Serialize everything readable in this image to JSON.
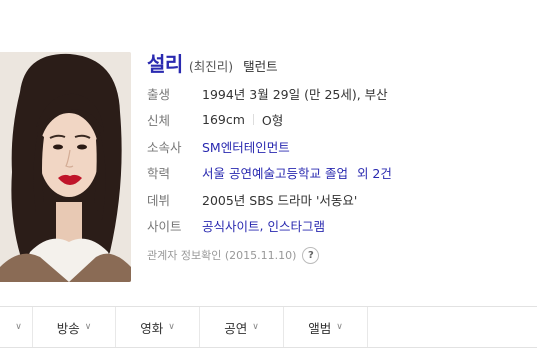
{
  "profile": {
    "name": "설리",
    "real_name": "(최진리)",
    "job": "탤런트",
    "rows": {
      "birth": {
        "label": "출생",
        "value": "1994년 3월 29일 (만 25세), 부산"
      },
      "body": {
        "label": "신체",
        "height": "169cm",
        "blood": "O형"
      },
      "agency": {
        "label": "소속사",
        "value": "SM엔터테인먼트"
      },
      "education": {
        "label": "학력",
        "value": "서울 공연예술고등학교 졸업",
        "more": "외 2건"
      },
      "debut": {
        "label": "데뷔",
        "value": "2005년 SBS 드라마 '서동요'"
      },
      "site": {
        "label": "사이트",
        "links": [
          "공식사이트",
          "인스타그램"
        ]
      }
    },
    "verify_text": "관계자 정보확인 (2015.11.10)",
    "help_icon": "?"
  },
  "tabs": [
    {
      "label": ""
    },
    {
      "label": "방송"
    },
    {
      "label": "영화"
    },
    {
      "label": "공연"
    },
    {
      "label": "앨범"
    }
  ],
  "colors": {
    "accent": "#2a2ab0",
    "border": "#e2e2e2",
    "lip": "#c0152a"
  }
}
